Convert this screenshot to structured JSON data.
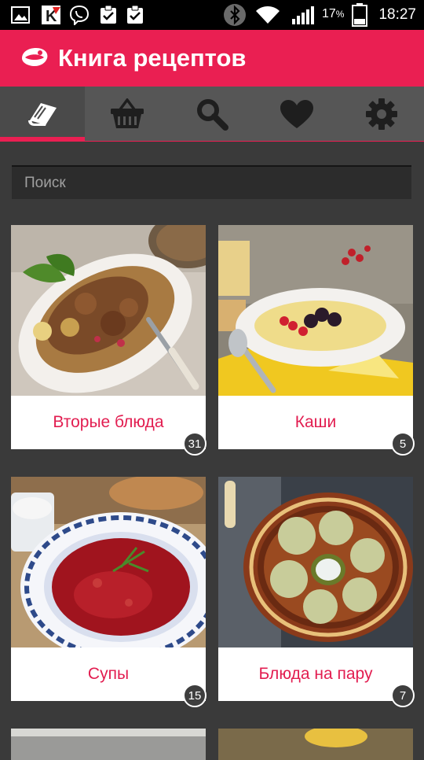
{
  "status_bar": {
    "battery": "17",
    "battery_unit": "%",
    "time": "18:27",
    "icons": [
      "gallery-icon",
      "kaspersky-icon",
      "viber-icon",
      "task-icon",
      "task-icon",
      "bluetooth-icon",
      "wifi-icon",
      "signal-icon",
      "battery-icon"
    ]
  },
  "app_bar": {
    "title": "Книга рецептов",
    "color": "#ea1f52"
  },
  "tabs": [
    {
      "icon": "book-icon",
      "active": true
    },
    {
      "icon": "basket-icon",
      "active": false
    },
    {
      "icon": "search-icon",
      "active": false
    },
    {
      "icon": "heart-icon",
      "active": false
    },
    {
      "icon": "gear-icon",
      "active": false
    }
  ],
  "search": {
    "placeholder": "Поиск",
    "value": ""
  },
  "categories": [
    {
      "name": "Вторые блюда",
      "count": "31"
    },
    {
      "name": "Каши",
      "count": "5"
    },
    {
      "name": "Супы",
      "count": "15"
    },
    {
      "name": "Блюда на пару",
      "count": "7"
    }
  ],
  "colors": {
    "accent": "#ea1f52",
    "background": "#3a3a3a",
    "tab_bar": "#565656"
  }
}
